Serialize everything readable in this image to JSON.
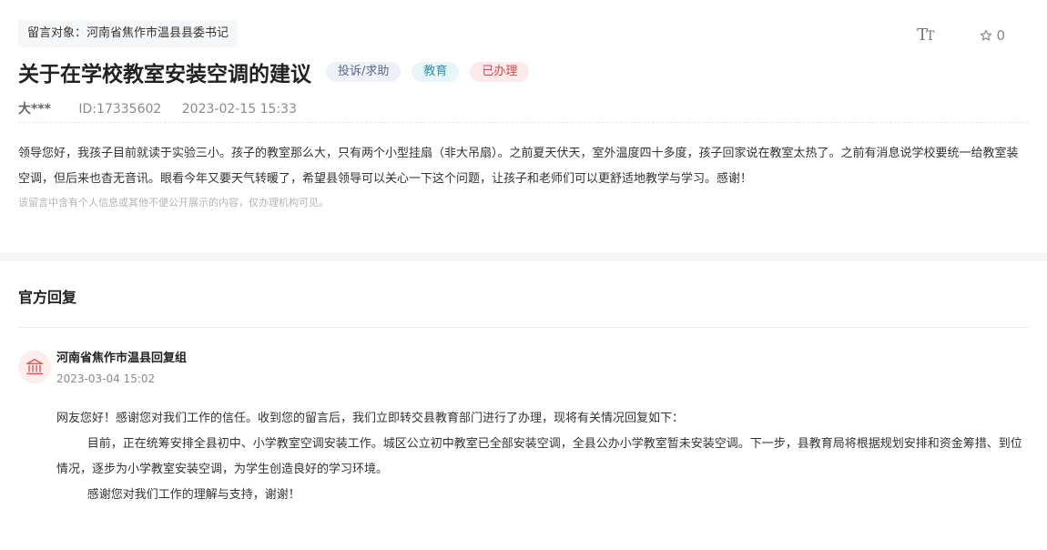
{
  "message": {
    "target": "留言对象：河南省焦作市温县县委书记",
    "font_size_icon": "text-size-icon",
    "favorite_icon": "star-outline-icon",
    "favorite_count": "0",
    "title": "关于在学校教室安装空调的建议",
    "tags": {
      "type": "投诉/求助",
      "field": "教育",
      "status": "已办理"
    },
    "author": "大***",
    "id": "ID:17335602",
    "datetime": "2023-02-15 15:33",
    "content": "领导您好，我孩子目前就读于实验三小。孩子的教室那么大，只有两个小型挂扇（非大吊扇）。之前夏天伏天，室外温度四十多度，孩子回家说在教室太热了。之前有消息说学校要统一给教室装空调，但后来也杳无音讯。眼看今年又要天气转暖了，希望县领导可以关心一下这个问题，让孩子和老师们可以更舒适地教学与学习。感谢！",
    "privacy_note": "该留言中含有个人信息或其他不便公开展示的内容，仅办理机构可见。"
  },
  "reply": {
    "heading": "官方回复",
    "avatar_icon": "government-building-icon",
    "replier": "河南省焦作市温县回复组",
    "datetime": "2023-03-04 15:02",
    "paragraphs": [
      "网友您好！感谢您对我们工作的信任。收到您的留言后，我们立即转交县教育部门进行了办理，现将有关情况回复如下：",
      "目前，正在统筹安排全县初中、小学教室空调安装工作。城区公立初中教室已全部安装空调，全县公办小学教室暂未安装空调。下一步，县教育局将根据规划安排和资金筹措、到位情况，逐步为小学教室安装空调，为学生创造良好的学习环境。",
      "感谢您对我们工作的理解与支持，谢谢！"
    ]
  },
  "colors": {
    "tag_type_bg": "#eef1f7",
    "tag_field_bg": "#e9f6f9",
    "tag_status_bg": "#fdeaea",
    "status_text": "#d64545",
    "avatar_accent": "#e05a5a"
  }
}
